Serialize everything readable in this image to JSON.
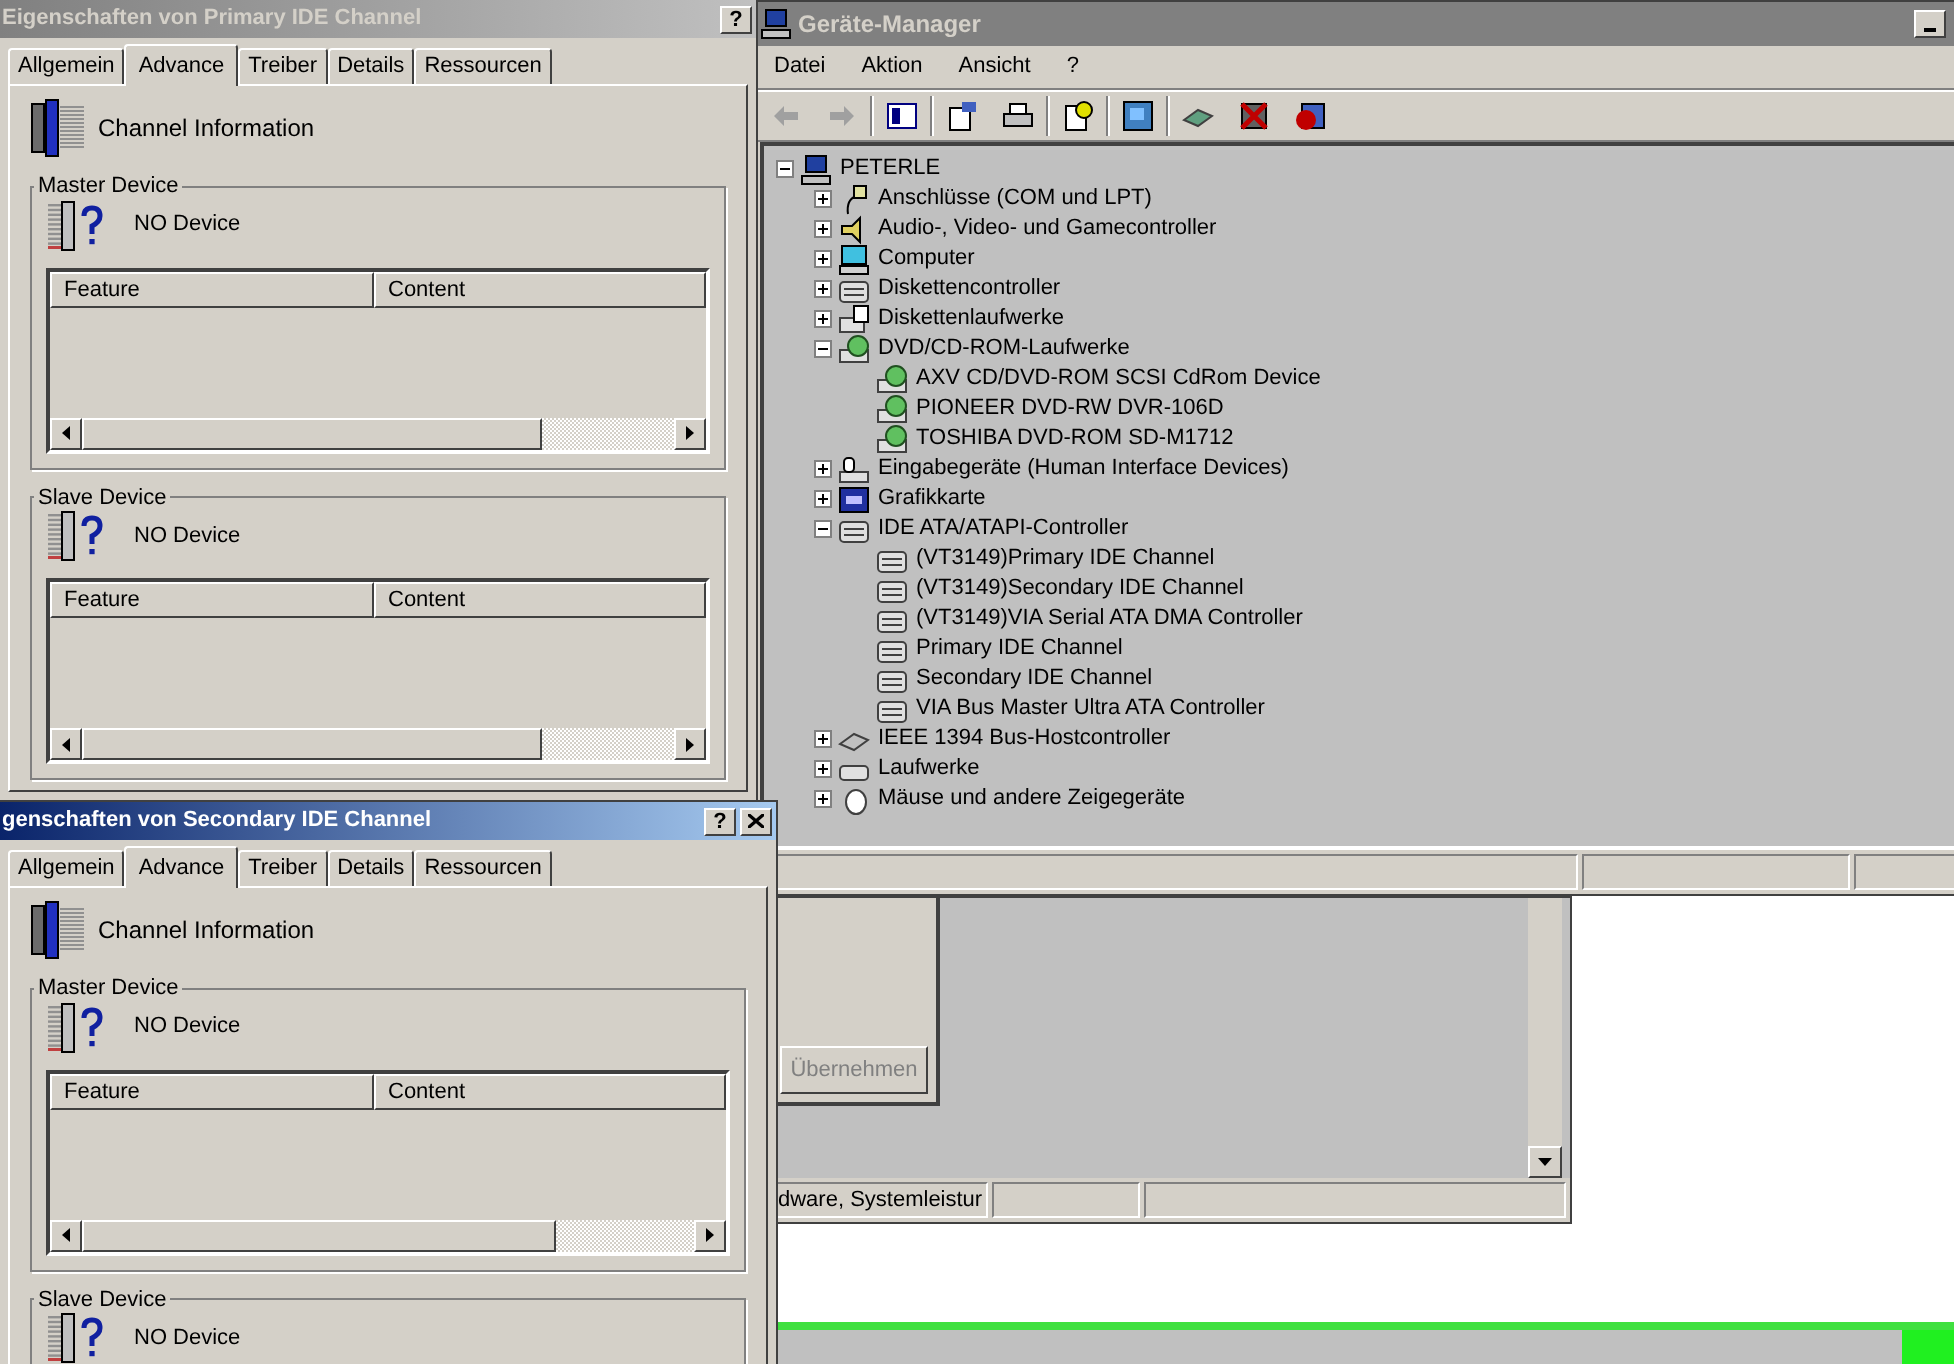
{
  "back_window": {
    "apply_button": {
      "label": "Übernehmen",
      "disabled": true
    },
    "status_text": "dware, Systemleistur"
  },
  "device_manager": {
    "title": "Geräte-Manager",
    "active": false,
    "menu": [
      "Datei",
      "Aktion",
      "Ansicht",
      "?"
    ],
    "tree": [
      {
        "label": "PETERLE",
        "kind": "computer",
        "expanded": true,
        "children": [
          {
            "label": "Anschlüsse (COM und LPT)",
            "kind": "port",
            "expanded": false
          },
          {
            "label": "Audio-, Video- und Gamecontroller",
            "kind": "audio",
            "expanded": false
          },
          {
            "label": "Computer",
            "kind": "monitor",
            "expanded": false
          },
          {
            "label": "Diskettencontroller",
            "kind": "controller",
            "expanded": false
          },
          {
            "label": "Diskettenlaufwerke",
            "kind": "floppy",
            "expanded": false
          },
          {
            "label": "DVD/CD-ROM-Laufwerke",
            "kind": "cdrom",
            "expanded": true,
            "children": [
              {
                "label": "AXV CD/DVD-ROM SCSI CdRom Device",
                "kind": "cdrom"
              },
              {
                "label": "PIONEER DVD-RW  DVR-106D",
                "kind": "cdrom"
              },
              {
                "label": "TOSHIBA DVD-ROM SD-M1712",
                "kind": "cdrom"
              }
            ]
          },
          {
            "label": "Eingabegeräte (Human Interface Devices)",
            "kind": "input",
            "expanded": false
          },
          {
            "label": "Grafikkarte",
            "kind": "display",
            "expanded": false
          },
          {
            "label": "IDE ATA/ATAPI-Controller",
            "kind": "controller",
            "expanded": true,
            "children": [
              {
                "label": "(VT3149)Primary IDE Channel",
                "kind": "controller"
              },
              {
                "label": "(VT3149)Secondary IDE Channel",
                "kind": "controller"
              },
              {
                "label": "(VT3149)VIA Serial ATA DMA Controller",
                "kind": "controller"
              },
              {
                "label": "Primary IDE Channel",
                "kind": "controller"
              },
              {
                "label": "Secondary IDE Channel",
                "kind": "controller"
              },
              {
                "label": "VIA Bus Master Ultra ATA Controller",
                "kind": "controller"
              }
            ]
          },
          {
            "label": "IEEE 1394 Bus-Hostcontroller",
            "kind": "ieee",
            "expanded": false
          },
          {
            "label": "Laufwerke",
            "kind": "drive",
            "expanded": false
          },
          {
            "label": "Mäuse und andere Zeigegeräte",
            "kind": "mouse",
            "expanded": false
          }
        ]
      }
    ]
  },
  "dialogs": [
    {
      "title": "Eigenschaften von Primary IDE Channel",
      "active": false,
      "help_button": "?",
      "closable": false,
      "tabs": [
        {
          "label": "Allgemein",
          "selected": false
        },
        {
          "label": "Advance",
          "selected": true
        },
        {
          "label": "Treiber",
          "selected": false
        },
        {
          "label": "Details",
          "selected": false
        },
        {
          "label": "Ressourcen",
          "selected": false
        }
      ],
      "header": "Channel Information",
      "groups": [
        {
          "title": "Master Device",
          "status": "NO Device",
          "columns": [
            "Feature",
            "Content"
          ]
        },
        {
          "title": "Slave Device",
          "status": "NO Device",
          "columns": [
            "Feature",
            "Content"
          ]
        }
      ]
    },
    {
      "title": "genschaften von Secondary IDE Channel",
      "active": true,
      "help_button": "?",
      "closable": true,
      "tabs": [
        {
          "label": "Allgemein",
          "selected": false
        },
        {
          "label": "Advance",
          "selected": true
        },
        {
          "label": "Treiber",
          "selected": false
        },
        {
          "label": "Details",
          "selected": false
        },
        {
          "label": "Ressourcen",
          "selected": false
        }
      ],
      "header": "Channel Information",
      "groups": [
        {
          "title": "Master Device",
          "status": "NO Device",
          "columns": [
            "Feature",
            "Content"
          ]
        },
        {
          "title": "Slave Device",
          "status": "NO Device"
        }
      ]
    }
  ]
}
